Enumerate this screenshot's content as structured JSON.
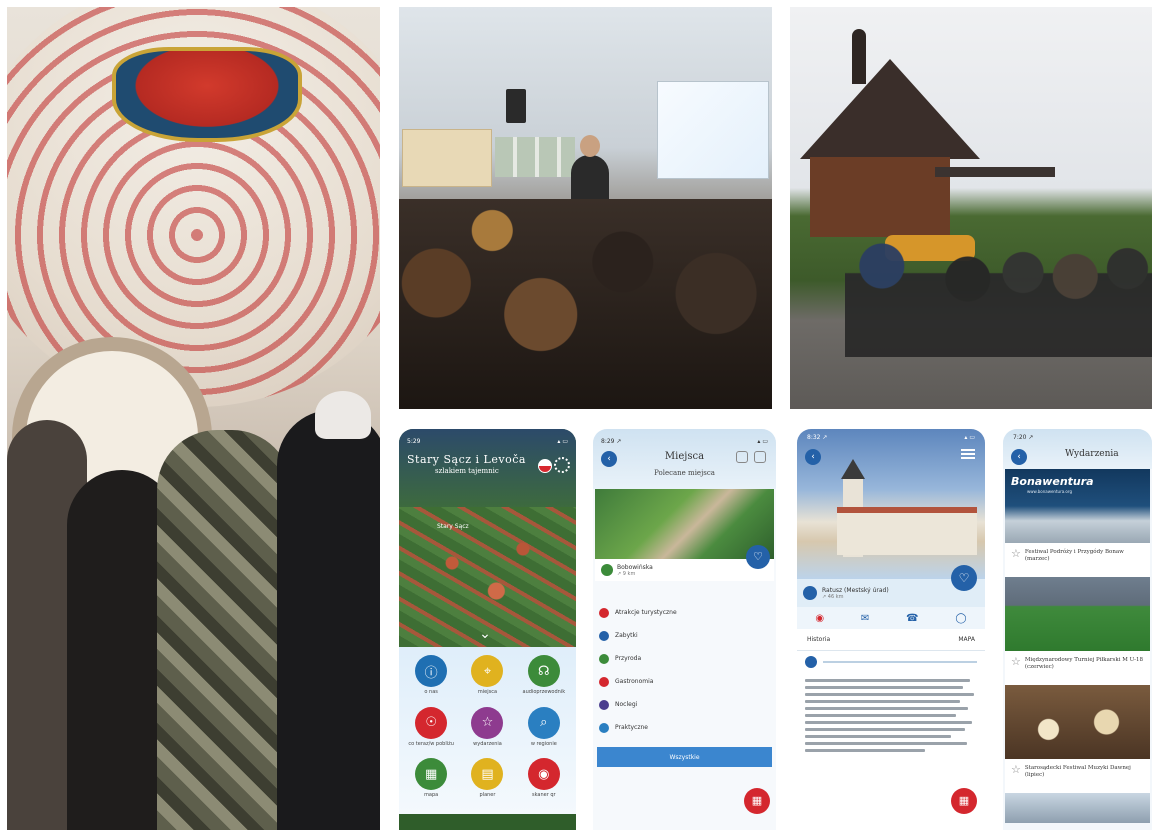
{
  "photos": [
    {
      "subject": "painted-vaulted-hall"
    },
    {
      "subject": "lecture-room"
    },
    {
      "subject": "wooden-church"
    }
  ],
  "phone_map": {
    "status_time": "5:29 ",
    "status_right": "▴ ▭",
    "app_title": "Stary Sącz i Levoča",
    "app_subtitle": "szlakiem tajemnic",
    "aerial_label": "Stary Sącz",
    "menu": [
      {
        "label": "o nas",
        "color": "#1f6fb2",
        "icon": "info-icon"
      },
      {
        "label": "miejsca",
        "color": "#e0b21f",
        "icon": "pin-icon"
      },
      {
        "label": "audioprzewodnik",
        "color": "#3c8b3a",
        "icon": "headphones-icon"
      },
      {
        "label": "co teraz/w pobliżu",
        "color": "#d4272e",
        "icon": "compass-icon"
      },
      {
        "label": "wydarzenia",
        "color": "#8e3b8f",
        "icon": "star-icon"
      },
      {
        "label": "w regionie",
        "color": "#2a7fc1",
        "icon": "search-icon"
      },
      {
        "label": "mapa",
        "color": "#3c8b3a",
        "icon": "map-icon"
      },
      {
        "label": "planer",
        "color": "#e0b21f",
        "icon": "calendar-icon"
      },
      {
        "label": "skaner qr",
        "color": "#d4272e",
        "icon": "eye-icon"
      }
    ]
  },
  "phone_places": {
    "status_time": "8:29 ↗",
    "title": "Miejsca",
    "subtitle": "Polecane miejsca",
    "place_name": "Bobowińska",
    "place_distance": "↗ 9 km",
    "categories": [
      {
        "label": "Atrakcje turystyczne",
        "color": "#d4272e"
      },
      {
        "label": "Zabytki",
        "color": "#2461a8"
      },
      {
        "label": "Przyroda",
        "color": "#3c8b3a"
      },
      {
        "label": "Gastronomia",
        "color": "#d4272e"
      },
      {
        "label": "Noclegi",
        "color": "#4a3d8e"
      },
      {
        "label": "Praktyczne",
        "color": "#2a7fc1"
      }
    ],
    "all_button": "Wszystkie"
  },
  "phone_detail": {
    "status_time": "8:32 ↗",
    "place_name": "Ratusz (Mestský úrad)",
    "place_distance": "↗ 46 km",
    "tab_left": "Historia",
    "tab_right": "MAPA"
  },
  "phone_events": {
    "status_time": "7:20 ↗",
    "title": "Wydarzenia",
    "bona_logo": "Bonawentura",
    "bona_url": "www.bonawentura.org",
    "events": [
      {
        "title": "Festiwal Podróży i Przygódy Bonaw (marzec)"
      },
      {
        "title": "Międzynarodowy Turniej Piłkarski M U-18 (czerwiec)"
      },
      {
        "title": "Starosądecki Festiwal Muzyki Dawnej (lipiec)"
      }
    ]
  }
}
